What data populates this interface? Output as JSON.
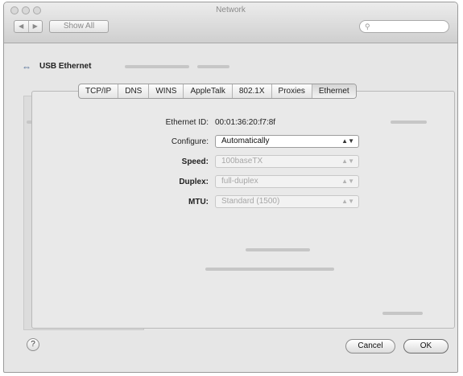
{
  "window": {
    "title": "Network"
  },
  "toolbar": {
    "back_icon": "back-icon",
    "forward_icon": "forward-icon",
    "show_all_label": "Show All",
    "search_placeholder": ""
  },
  "header": {
    "icon": "network-link-icon",
    "label": "USB Ethernet"
  },
  "tabs": [
    {
      "label": "TCP/IP",
      "selected": false
    },
    {
      "label": "DNS",
      "selected": false
    },
    {
      "label": "WINS",
      "selected": false
    },
    {
      "label": "AppleTalk",
      "selected": false
    },
    {
      "label": "802.1X",
      "selected": false
    },
    {
      "label": "Proxies",
      "selected": false
    },
    {
      "label": "Ethernet",
      "selected": true
    }
  ],
  "ethernet": {
    "ethernet_id_label": "Ethernet ID:",
    "ethernet_id_value": "00:01:36:20:f7:8f",
    "configure_label": "Configure:",
    "configure_value": "Automatically",
    "speed_label": "Speed:",
    "speed_value": "100baseTX",
    "duplex_label": "Duplex:",
    "duplex_value": "full-duplex",
    "mtu_label": "MTU:",
    "mtu_value": "Standard (1500)"
  },
  "footer": {
    "help_label": "?",
    "cancel_label": "Cancel",
    "ok_label": "OK"
  }
}
